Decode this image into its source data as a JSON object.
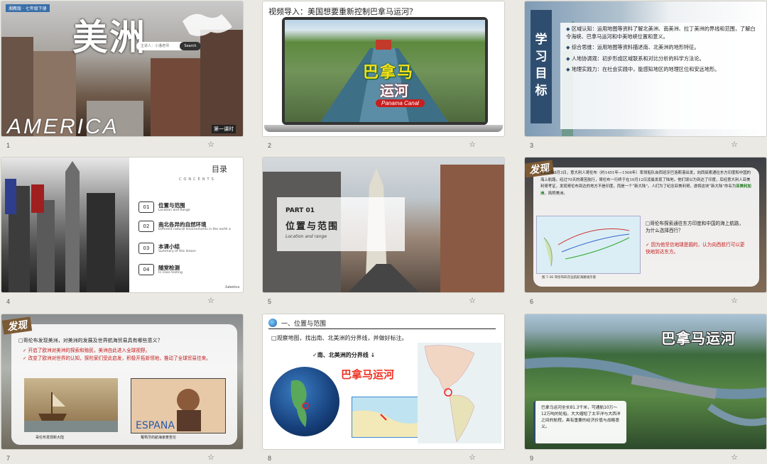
{
  "slides": [
    {
      "number": "1",
      "top_tag": "湘教版 · 七年级下册",
      "title_cn": "美洲",
      "title_en": "AMERICA",
      "search_placeholder": "主讲人：小潘老师",
      "search_button": "Search",
      "lesson": "第一课时"
    },
    {
      "number": "2",
      "title": "视频导入：美国想要重新控制巴拿马运河？",
      "canal_line1": "巴拿马",
      "canal_line2": "运河",
      "canal_en": "Panama Canal"
    },
    {
      "number": "3",
      "side_label": "学习目标",
      "items": [
        {
          "head": "区域认知：",
          "text": "运用地图等资料了解北美洲、南美洲、拉丁美洲的界线和范围，了解白令海峡、巴拿马运河和中美地峡位置和意义。"
        },
        {
          "head": "综合思维：",
          "text": "运用地图等资料描述南、北美洲的地形特征。"
        },
        {
          "head": "人地协调观：",
          "text": "初步形成区域联系和对比分析的科学方法论。"
        },
        {
          "head": "地理实践力：",
          "text": "在社会实践中，能感知地区的地理区位和安远地形。"
        }
      ]
    },
    {
      "number": "4",
      "heading": "目录",
      "contents_label": "CONCENTS",
      "entries": [
        {
          "no": "01",
          "cn": "位置与范围",
          "en": "Location and Range"
        },
        {
          "no": "02",
          "cn": "南北各异的自然环境",
          "en": "Different natural environments in the north a"
        },
        {
          "no": "03",
          "cn": "本课小结",
          "en": "Summary of this lesson"
        },
        {
          "no": "04",
          "cn": "随堂检测",
          "en": "In class testing"
        }
      ],
      "brand": "America"
    },
    {
      "number": "5",
      "part": "PART 01",
      "title": "位置与范围",
      "subtitle": "Location and range"
    },
    {
      "number": "6",
      "badge": "发现",
      "paragraph_pre": "1492年8月3日，意大利人哥伦布（约1451年—1506年）率领船队自西班牙巴洛斯港出发，向西探索通往东方印度和中国的海上航路。经过70天的艰苦航行，哥伦布一行终于在10月12日凌晨发现了陆地。他们误以为到达了印度，后经意大利人亚美利哥考证，发现哥伦布到达的地方不是印度，而是一个“新大陆”。人们为了纪念亚美利哥，遂将这块“新大陆”命名为",
      "paragraph_hl": "亚美利加洲",
      "paragraph_post": "，简称美洲。",
      "map_caption": "图 7-36  哥伦布四次远航航海路线示意",
      "question": "哥伦布探索通往东方印度和中国的海上航路，为什么选择西行？",
      "answer": "因为他坚信地球是圆的，认为向西航行可以更快地到达东方。"
    },
    {
      "number": "7",
      "badge": "发现",
      "question": "哥伦布发现美洲，对美洲的发展及世界航海贸易具有哪些意义？",
      "answers": [
        "开启了欧洲对美洲的探索和殖民，美洲由此进入全球视野。",
        "改变了欧洲对世界的认知，探险家们受此启发，积极开拓新领地，推动了全球贸易往来。"
      ],
      "caption1": "哥伦布发现新大陆",
      "caption2": "葡萄牙的航海家麦哲伦",
      "stamp_text": "ESPANA"
    },
    {
      "number": "8",
      "section": "一、位置与范围",
      "task": "观察地图，找出南、北美洲的分界线，并做好标注。",
      "border_label": "南、北美洲的分界线",
      "canal_label": "巴拿马运河"
    },
    {
      "number": "9",
      "title": "巴拿马运河",
      "note": "巴拿马运河全长81.3千米，可通航10万～12万吨的轮船。大大缩短了太平洋与大西洋之间的航程，具有重要的经济价值与战略意义。"
    }
  ],
  "star_icon": "☆",
  "colors": {
    "background": "#eae9e3",
    "accent_red": "#c21b1b",
    "navy": "#2f4e6f",
    "badge_brown": "#7c5a34"
  }
}
